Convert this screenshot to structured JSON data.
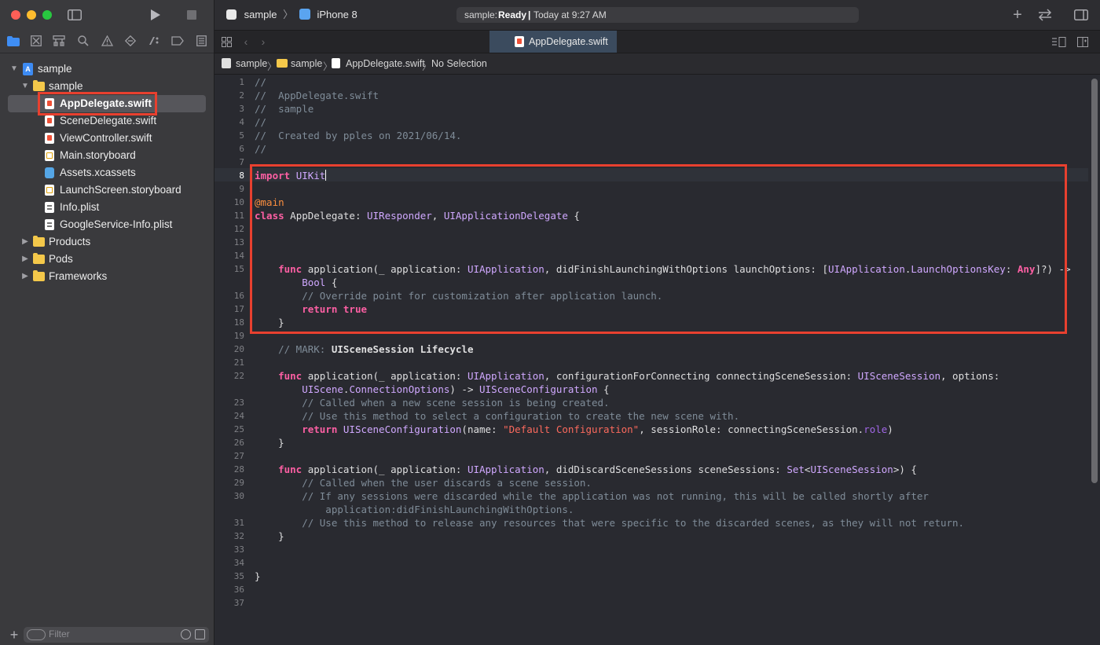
{
  "toolbar": {
    "scheme": "sample",
    "device": "iPhone 8",
    "status_prefix": "sample: ",
    "status_state": "Ready",
    "status_sep": " | ",
    "status_time": "Today at 9:27 AM",
    "add_label": "+"
  },
  "tabs": [
    {
      "label": "AppDelegate.swift",
      "active": true
    }
  ],
  "jumpbar": {
    "project": "sample",
    "group": "sample",
    "file": "AppDelegate.swift",
    "selection": "No Selection"
  },
  "navigator": {
    "project": "sample",
    "group": "sample",
    "files": [
      {
        "name": "AppDelegate.swift",
        "icon": "swift-file-icon",
        "selected": true
      },
      {
        "name": "SceneDelegate.swift",
        "icon": "swift-file-icon"
      },
      {
        "name": "ViewController.swift",
        "icon": "swift-file-icon"
      },
      {
        "name": "Main.storyboard",
        "icon": "storyboard-file-icon"
      },
      {
        "name": "Assets.xcassets",
        "icon": "asset-catalog-icon"
      },
      {
        "name": "LaunchScreen.storyboard",
        "icon": "storyboard-file-icon"
      },
      {
        "name": "Info.plist",
        "icon": "plist-file-icon"
      },
      {
        "name": "GoogleService-Info.plist",
        "icon": "plist-file-icon"
      }
    ],
    "groups": [
      "Products",
      "Pods",
      "Frameworks"
    ],
    "filter_placeholder": "Filter"
  },
  "editor": {
    "current_line": 8,
    "line_numbers": [
      "1",
      "2",
      "3",
      "4",
      "5",
      "6",
      "7",
      "8",
      "9",
      "10",
      "11",
      "12",
      "13",
      "14",
      "15",
      "",
      "16",
      "17",
      "18",
      "19",
      "20",
      "21",
      "22",
      "",
      "23",
      "24",
      "25",
      "26",
      "27",
      "28",
      "29",
      "30",
      "",
      "31",
      "32",
      "33",
      "34",
      "35",
      "36",
      "37"
    ],
    "lines": [
      {
        "t": "//",
        "c": "cm"
      },
      {
        "t": "//  AppDelegate.swift",
        "c": "cm"
      },
      {
        "t": "//  sample",
        "c": "cm"
      },
      {
        "t": "//",
        "c": "cm"
      },
      {
        "t": "//  Created by pples on 2021/06/14.",
        "c": "cm"
      },
      {
        "t": "//",
        "c": "cm"
      },
      {
        "t": ""
      },
      {
        "t": "import UIKit"
      },
      {
        "t": ""
      },
      {
        "t": "@main"
      },
      {
        "t": "class AppDelegate: UIResponder, UIApplicationDelegate {"
      },
      {
        "t": ""
      },
      {
        "t": ""
      },
      {
        "t": ""
      },
      {
        "t": "    func application(_ application: UIApplication, didFinishLaunchingWithOptions launchOptions: [UIApplication.LaunchOptionsKey: Any]?) ->"
      },
      {
        "t": "        Bool {"
      },
      {
        "t": "        // Override point for customization after application launch.",
        "c": "cm"
      },
      {
        "t": "        return true"
      },
      {
        "t": "    }"
      },
      {
        "t": ""
      },
      {
        "t": "    // MARK: UISceneSession Lifecycle"
      },
      {
        "t": ""
      },
      {
        "t": "    func application(_ application: UIApplication, configurationForConnecting connectingSceneSession: UISceneSession, options:"
      },
      {
        "t": "        UIScene.ConnectionOptions) -> UISceneConfiguration {"
      },
      {
        "t": "        // Called when a new scene session is being created.",
        "c": "cm"
      },
      {
        "t": "        // Use this method to select a configuration to create the new scene with.",
        "c": "cm"
      },
      {
        "t": "        return UISceneConfiguration(name: \"Default Configuration\", sessionRole: connectingSceneSession.role)"
      },
      {
        "t": "    }"
      },
      {
        "t": ""
      },
      {
        "t": "    func application(_ application: UIApplication, didDiscardSceneSessions sceneSessions: Set<UISceneSession>) {"
      },
      {
        "t": "        // Called when the user discards a scene session.",
        "c": "cm"
      },
      {
        "t": "        // If any sessions were discarded while the application was not running, this will be called shortly after",
        "c": "cm"
      },
      {
        "t": "            application:didFinishLaunchingWithOptions.",
        "c": "cm"
      },
      {
        "t": "        // Use this method to release any resources that were specific to the discarded scenes, as they will not return.",
        "c": "cm"
      },
      {
        "t": "    }"
      },
      {
        "t": ""
      },
      {
        "t": ""
      },
      {
        "t": "}"
      },
      {
        "t": ""
      },
      {
        "t": ""
      }
    ]
  },
  "colors": {
    "keyword": "#fc5fa3",
    "type": "#d0a8ff",
    "comment": "#7f8c98",
    "string": "#fc6a5d",
    "highlight_box": "#e8402f"
  }
}
